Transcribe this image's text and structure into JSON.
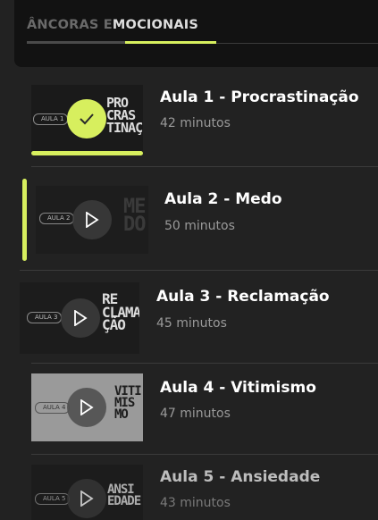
{
  "module": {
    "tab_prefix": "ÂNCORAS E",
    "tab_rest": "MOCIONAIS"
  },
  "lessons": [
    {
      "title": "Aula 1 - Procrastinação",
      "duration": "42 minutos",
      "thumb_text": "PRO\nCRAS\nTINAÇ",
      "thumb_pill": "AULA 1",
      "status": "completed",
      "progress": 1.0
    },
    {
      "title": "Aula 2 - Medo",
      "duration": "50 minutos",
      "thumb_text": "ME\nDO",
      "thumb_pill": "AULA 2",
      "status": "active"
    },
    {
      "title": "Aula 3 - Reclamação",
      "duration": "45 minutos",
      "thumb_text": "RE\nCLAMA\nÇÃO",
      "thumb_pill": "AULA 3",
      "status": "available"
    },
    {
      "title": "Aula 4 - Vitimismo",
      "duration": "47 minutos",
      "thumb_text": "VITI\nMIS\nMO",
      "thumb_pill": "AULA 4",
      "status": "available"
    },
    {
      "title": "Aula 5 - Ansiedade",
      "duration": "43 minutos",
      "thumb_text": "ANSI\nEDADE",
      "thumb_pill": "AULA 5",
      "status": "available"
    }
  ],
  "colors": {
    "accent": "#d7ef5e",
    "background": "#222222",
    "header": "#121212"
  }
}
